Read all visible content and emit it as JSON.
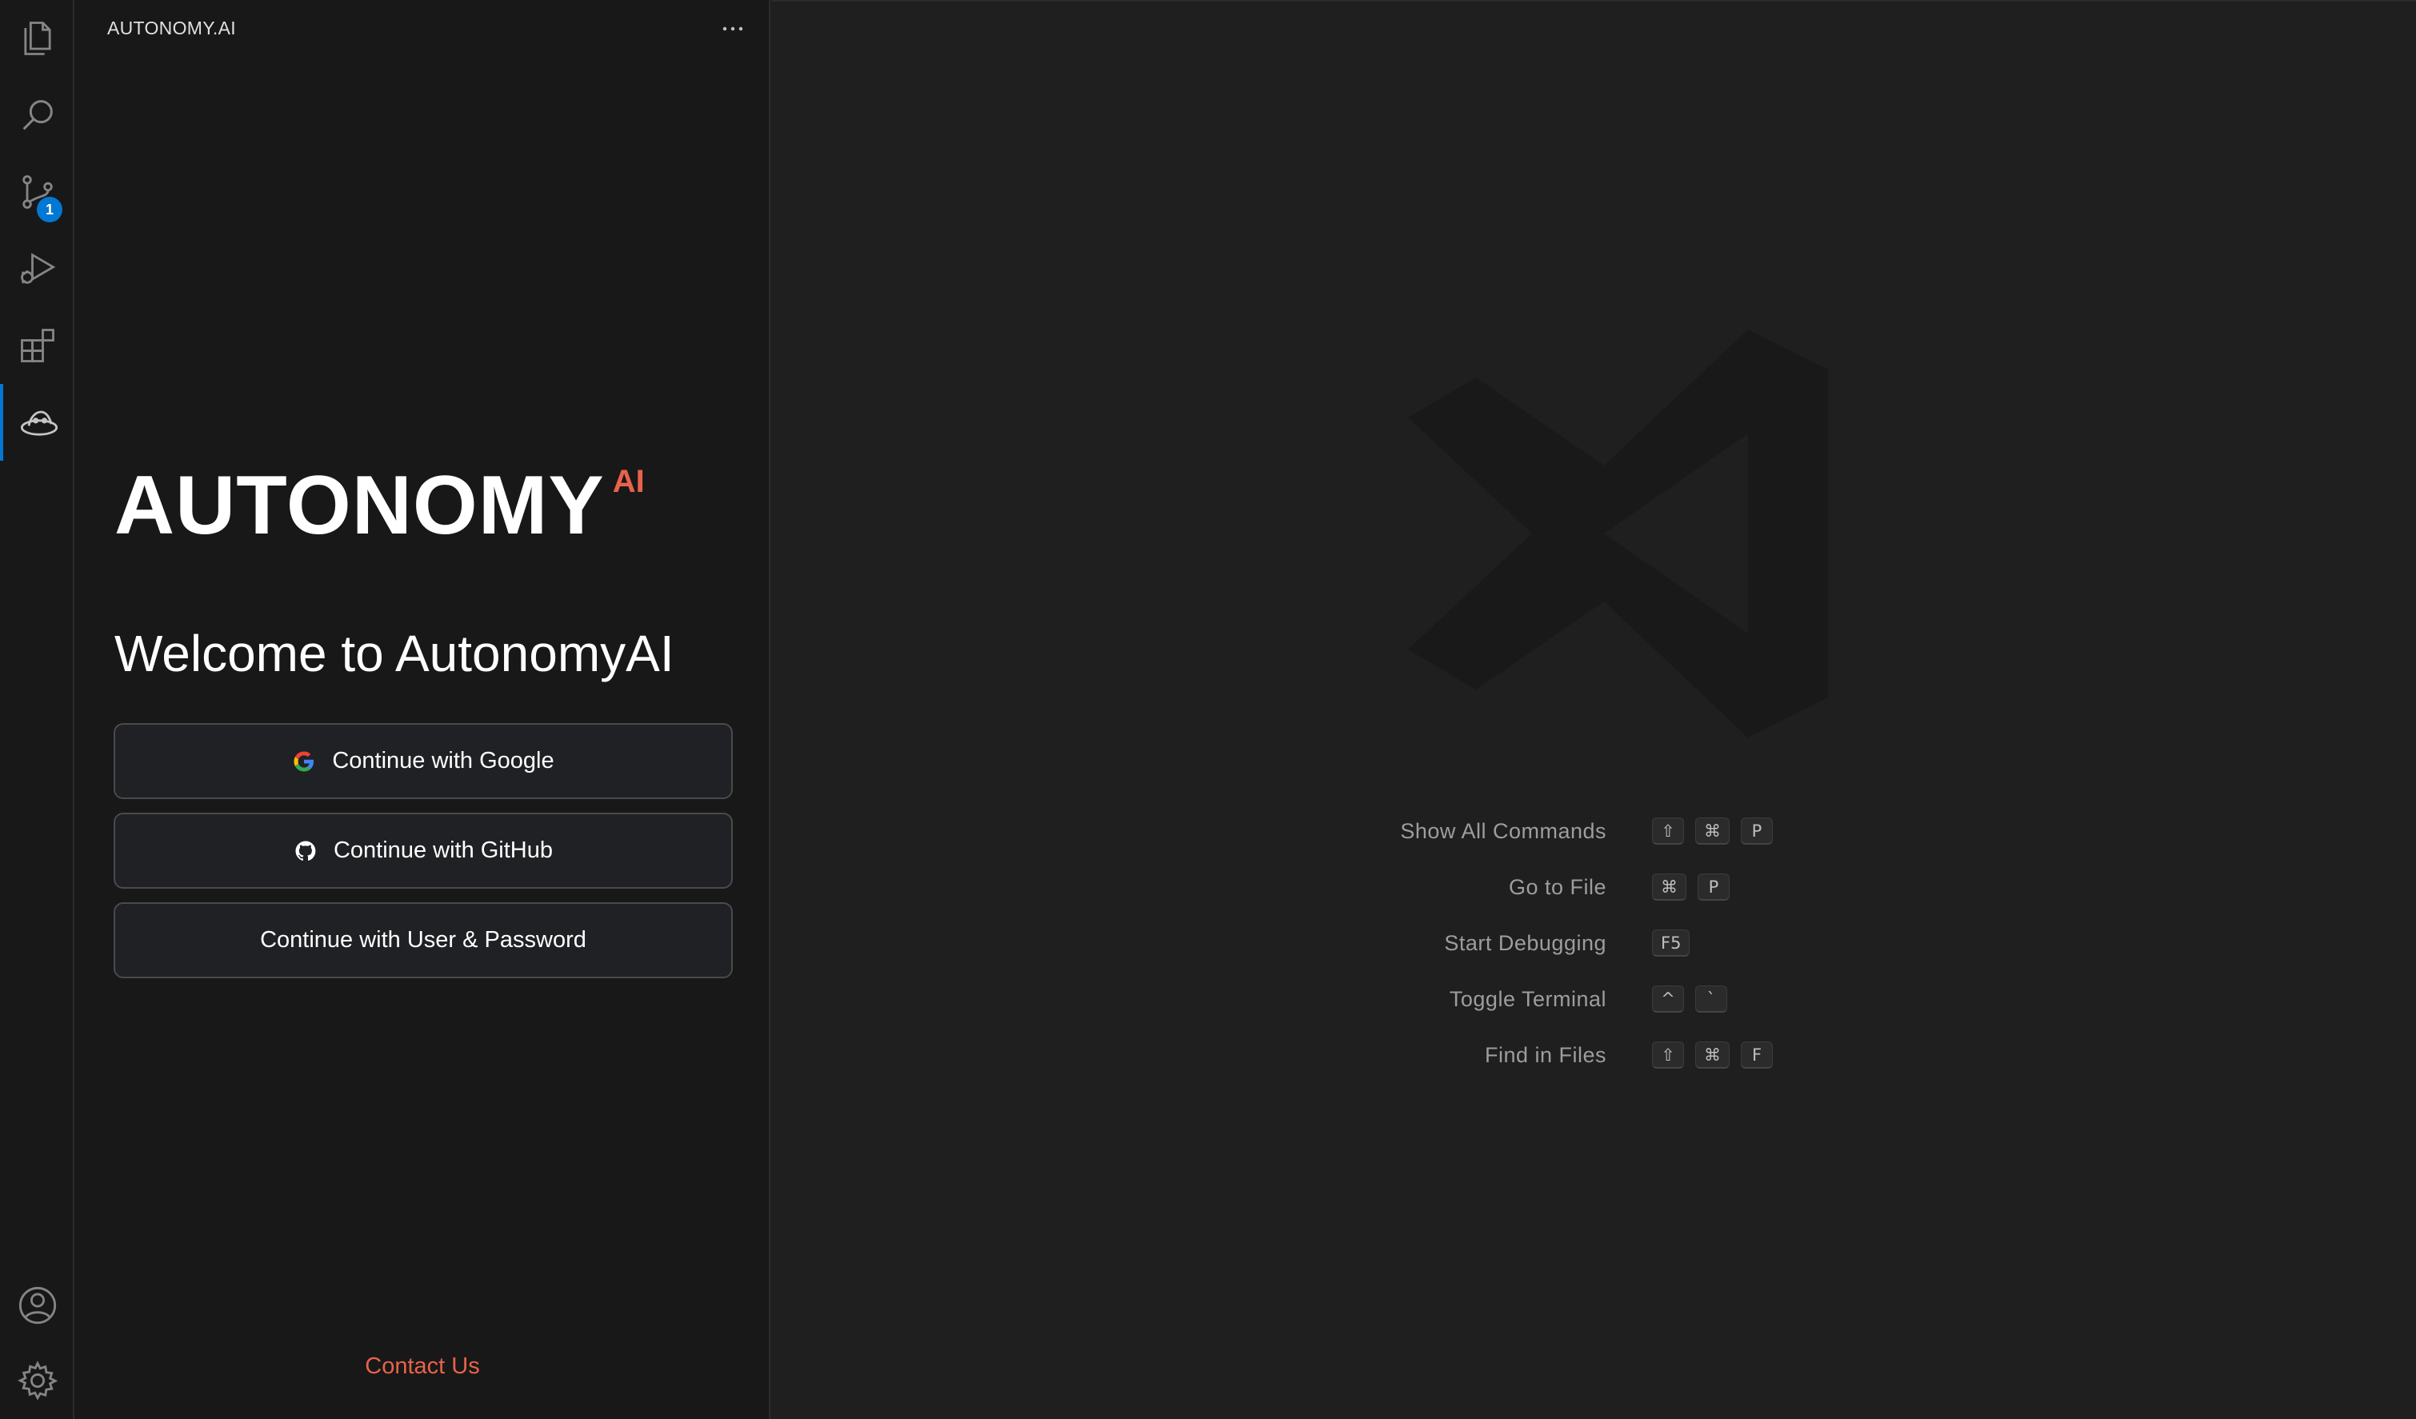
{
  "activity_bar": {
    "items": [
      {
        "icon": "files-icon"
      },
      {
        "icon": "search-icon"
      },
      {
        "icon": "source-control-icon",
        "badge": "1"
      },
      {
        "icon": "run-debug-icon"
      },
      {
        "icon": "extensions-icon"
      },
      {
        "icon": "autonomy-icon",
        "active": true
      }
    ],
    "bottom": [
      {
        "icon": "account-icon"
      },
      {
        "icon": "gear-icon"
      }
    ]
  },
  "sidebar": {
    "title": "AUTONOMY.AI",
    "more_label": "···",
    "brand_main": "AUTONOMY",
    "brand_sup": "AI",
    "welcome": "Welcome to AutonomyAI",
    "buttons": {
      "google": "Continue with Google",
      "github": "Continue with GitHub",
      "password": "Continue with User & Password"
    },
    "contact": "Contact Us"
  },
  "editor": {
    "shortcuts": [
      {
        "label": "Show All Commands",
        "keys": [
          "⇧",
          "⌘",
          "P"
        ]
      },
      {
        "label": "Go to File",
        "keys": [
          "⌘",
          "P"
        ]
      },
      {
        "label": "Start Debugging",
        "keys": [
          "F5"
        ]
      },
      {
        "label": "Toggle Terminal",
        "keys": [
          "^",
          "`"
        ]
      },
      {
        "label": "Find in Files",
        "keys": [
          "⇧",
          "⌘",
          "F"
        ]
      }
    ]
  },
  "colors": {
    "accent": "#0078d4",
    "brand": "#e8634a",
    "background": "#1f1f1f",
    "sidebar": "#181818"
  }
}
